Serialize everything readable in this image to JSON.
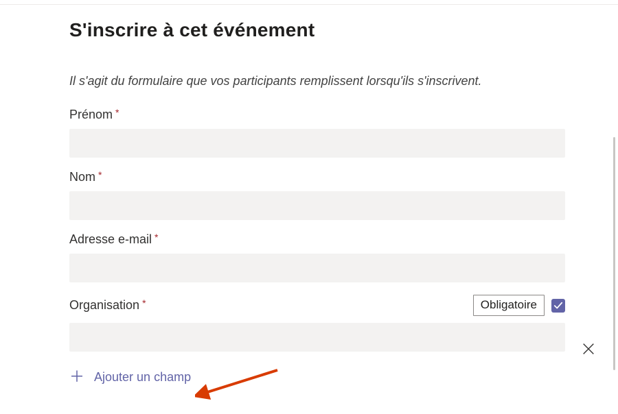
{
  "header": {
    "title": "S'inscrire à cet événement",
    "description": "Il s'agit du formulaire que vos participants remplissent lorsqu'ils s'inscrivent."
  },
  "fields": {
    "first_name": {
      "label": "Prénom",
      "value": ""
    },
    "last_name": {
      "label": "Nom",
      "value": ""
    },
    "email": {
      "label": "Adresse e-mail",
      "value": ""
    },
    "organization": {
      "label": "Organisation",
      "value": "",
      "required_label": "Obligatoire",
      "required_checked": true
    }
  },
  "actions": {
    "add_field_label": "Ajouter un champ"
  },
  "colors": {
    "accent": "#6264a7",
    "required": "#a4262c",
    "input_bg": "#f3f2f1"
  }
}
